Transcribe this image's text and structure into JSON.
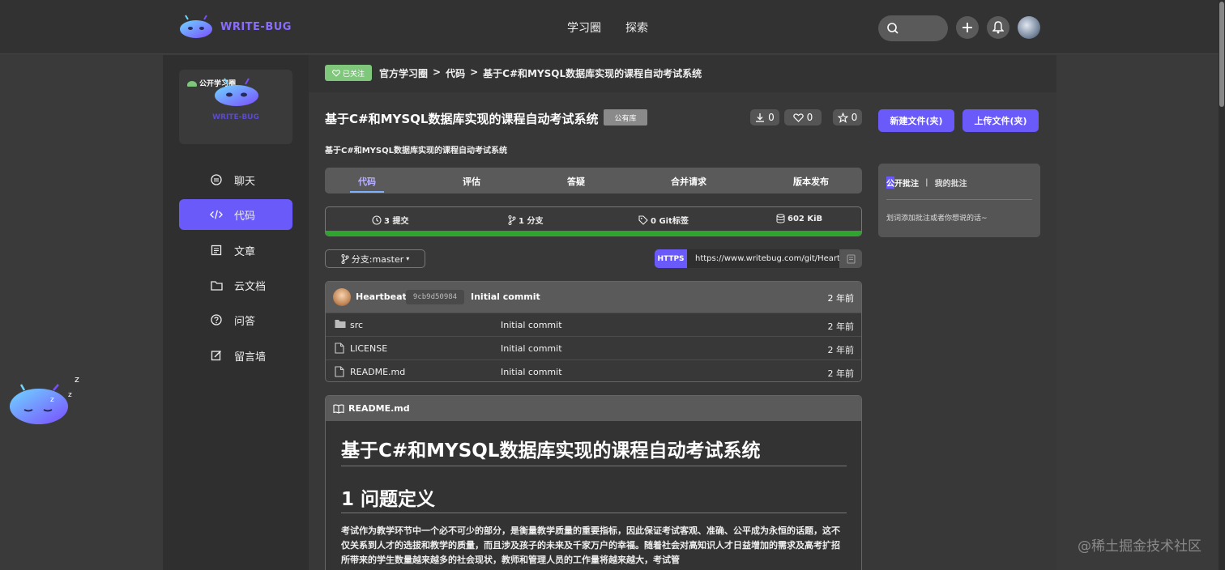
{
  "header": {
    "logo_text": "WRITE-BUG",
    "nav": [
      "学习圈",
      "探索"
    ],
    "icons": [
      "search-icon",
      "plus-icon",
      "bell-icon",
      "user-avatar"
    ]
  },
  "sidebar": {
    "circle_card": {
      "tag": "公开学习圈",
      "brand": "WRITE-BUG"
    },
    "items": [
      {
        "label": "聊天",
        "icon": "chat-icon"
      },
      {
        "label": "代码",
        "icon": "code-icon",
        "active": true
      },
      {
        "label": "文章",
        "icon": "article-icon"
      },
      {
        "label": "云文档",
        "icon": "folder-icon"
      },
      {
        "label": "问答",
        "icon": "question-icon"
      },
      {
        "label": "留言墙",
        "icon": "edit-icon"
      }
    ]
  },
  "breadcrumb": {
    "follow_badge": "已关注",
    "items": [
      "官方学习圈",
      "代码",
      "基于C#和MYSQL数据库实现的课程自动考试系统"
    ],
    "separator": ">"
  },
  "repo": {
    "title": "基于C#和MYSQL数据库实现的课程自动考试系统",
    "visibility": "公有库",
    "description": "基于C#和MYSQL数据库实现的课程自动考试系统",
    "downloads": "0",
    "likes": "0",
    "stars": "0"
  },
  "actions": {
    "new_file": "新建文件(夹)",
    "upload_file": "上传文件(夹)"
  },
  "tabs": [
    "代码",
    "评估",
    "答疑",
    "合并请求",
    "版本发布"
  ],
  "stats": {
    "commits": "3 提交",
    "branches": "1 分支",
    "tags": "0 Git标签",
    "size": "602 KiB"
  },
  "branch": {
    "label": "分支:master"
  },
  "clone": {
    "protocol": "HTTPS",
    "url": "https://www.writebug.com/git/Heartl"
  },
  "latest_commit": {
    "author": "Heartbeat",
    "hash": "9cb9d50984",
    "message": "Initial commit",
    "time": "2 年前"
  },
  "files": [
    {
      "name": "src",
      "type": "folder",
      "message": "Initial commit",
      "time": "2 年前"
    },
    {
      "name": "LICENSE",
      "type": "file",
      "message": "Initial commit",
      "time": "2 年前"
    },
    {
      "name": "README.md",
      "type": "file",
      "message": "Initial commit",
      "time": "2 年前"
    }
  ],
  "readme": {
    "filename": "README.md",
    "h1": "基于C#和MYSQL数据库实现的课程自动考试系统",
    "h2": "1 问题定义",
    "paragraph": "考试作为教学环节中一个必不可少的部分，是衡量教学质量的重要指标，因此保证考试客观、准确、公平成为永恒的话题，这不仅关系到人才的选拔和教学的质量，而且涉及孩子的未来及千家万户的幸福。随着社会对高知识人才日益增加的需求及高考扩招所带来的学生数量越来越多的社会现状，教师和管理人员的工作量将越来越大，考试管"
  },
  "annotations": {
    "tab_public": "公开批注",
    "separator": "|",
    "tab_mine": "我的批注",
    "hint": "划词添加批注或者你想说的话~"
  },
  "watermark": "@稀土掘金技术社区",
  "colors": {
    "accent": "#6a5af9",
    "success": "#2fa52f",
    "follow": "#7ec77b"
  }
}
